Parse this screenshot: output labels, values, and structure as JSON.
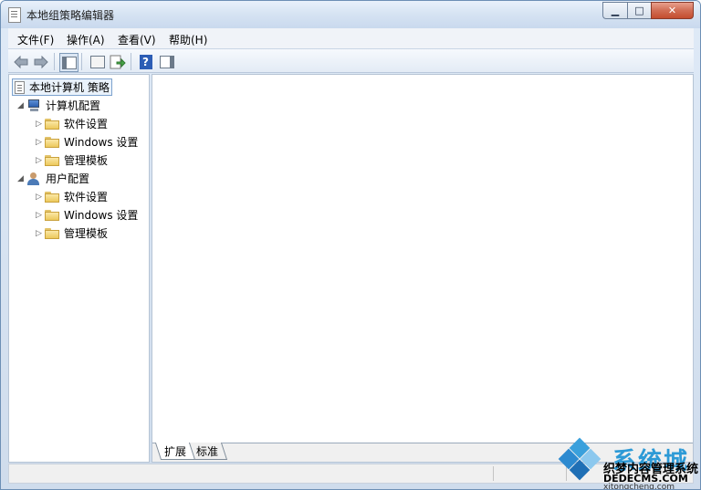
{
  "window": {
    "title": "本地组策略编辑器",
    "minimize_label": "▁",
    "maximize_label": "□",
    "close_label": "✕"
  },
  "menu": [
    {
      "label": "文件(F)"
    },
    {
      "label": "操作(A)"
    },
    {
      "label": "查看(V)"
    },
    {
      "label": "帮助(H)"
    }
  ],
  "toolbar": {
    "back_icon": "back-arrow-icon",
    "forward_icon": "forward-arrow-icon",
    "help_label": "?"
  },
  "tree": {
    "root": "本地计算机 策略",
    "computer_config": "计算机配置",
    "computer_children": [
      "软件设置",
      "Windows 设置",
      "管理模板"
    ],
    "user_config": "用户配置",
    "user_children": [
      "软件设置",
      "Windows 设置",
      "管理模板"
    ]
  },
  "tabs": [
    {
      "label": "扩展"
    },
    {
      "label": "标准"
    }
  ],
  "watermark": {
    "title": "系统城",
    "subtitle": "织梦内容管理系统",
    "url": "DEDECMS.COM",
    "small": "xitongcheng.com"
  }
}
